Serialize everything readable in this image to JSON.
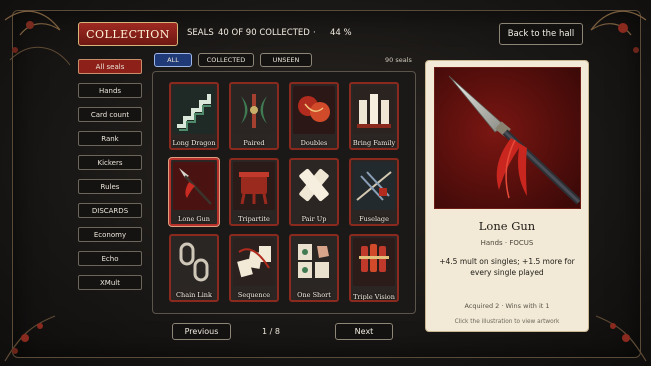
{
  "header": {
    "collection_label": "COLLECTION",
    "seals_label": "SEALS",
    "collected_text": "40 OF 90 COLLECTED",
    "separator": "·",
    "percent": "44 %",
    "back_label": "Back to the hall"
  },
  "filters": [
    {
      "label": "ALL",
      "active": true
    },
    {
      "label": "COLLECTED",
      "active": false
    },
    {
      "label": "UNSEEN",
      "active": false
    }
  ],
  "seal_count": "90 seals",
  "sidebar": {
    "items": [
      {
        "label": "All seals",
        "active": true
      },
      {
        "label": "Hands",
        "active": false
      },
      {
        "label": "Card count",
        "active": false
      },
      {
        "label": "Rank",
        "active": false
      },
      {
        "label": "Kickers",
        "active": false
      },
      {
        "label": "Rules",
        "active": false
      },
      {
        "label": "DISCARDS",
        "active": false
      },
      {
        "label": "Economy",
        "active": false
      },
      {
        "label": "Echo",
        "active": false
      },
      {
        "label": "XMult",
        "active": false
      }
    ]
  },
  "cards": [
    {
      "label": "Long Dragon",
      "icon": "stairs-icon"
    },
    {
      "label": "Paired",
      "icon": "paired-axes-icon"
    },
    {
      "label": "Doubles",
      "icon": "red-knot-icon"
    },
    {
      "label": "Bring Family",
      "icon": "tablets-icon"
    },
    {
      "label": "Lone Gun",
      "icon": "spear-icon"
    },
    {
      "label": "Tripartite",
      "icon": "cauldron-icon"
    },
    {
      "label": "Pair Up",
      "icon": "crossed-tiles-icon"
    },
    {
      "label": "Fuselage",
      "icon": "rafters-icon"
    },
    {
      "label": "Chain Link",
      "icon": "chain-icon"
    },
    {
      "label": "Sequence",
      "icon": "tiles-sequence-icon"
    },
    {
      "label": "One Short",
      "icon": "tiles-hand-icon"
    },
    {
      "label": "Triple Vision",
      "icon": "bundle-icon"
    }
  ],
  "pagination": {
    "prev_label": "Previous",
    "page_text": "1 / 8",
    "next_label": "Next"
  },
  "detail": {
    "title": "Lone Gun",
    "meta": "Hands · FOCUS",
    "description": "+4.5 mult on singles; +1.5 more for every single played",
    "stats": "Acquired 2 · Wins with it 1",
    "hint": "Click the illustration to view artwork"
  },
  "colors": {
    "accent_red": "#8d2018",
    "filter_active_blue": "#203a78",
    "panel_cream": "#f2ead6"
  }
}
